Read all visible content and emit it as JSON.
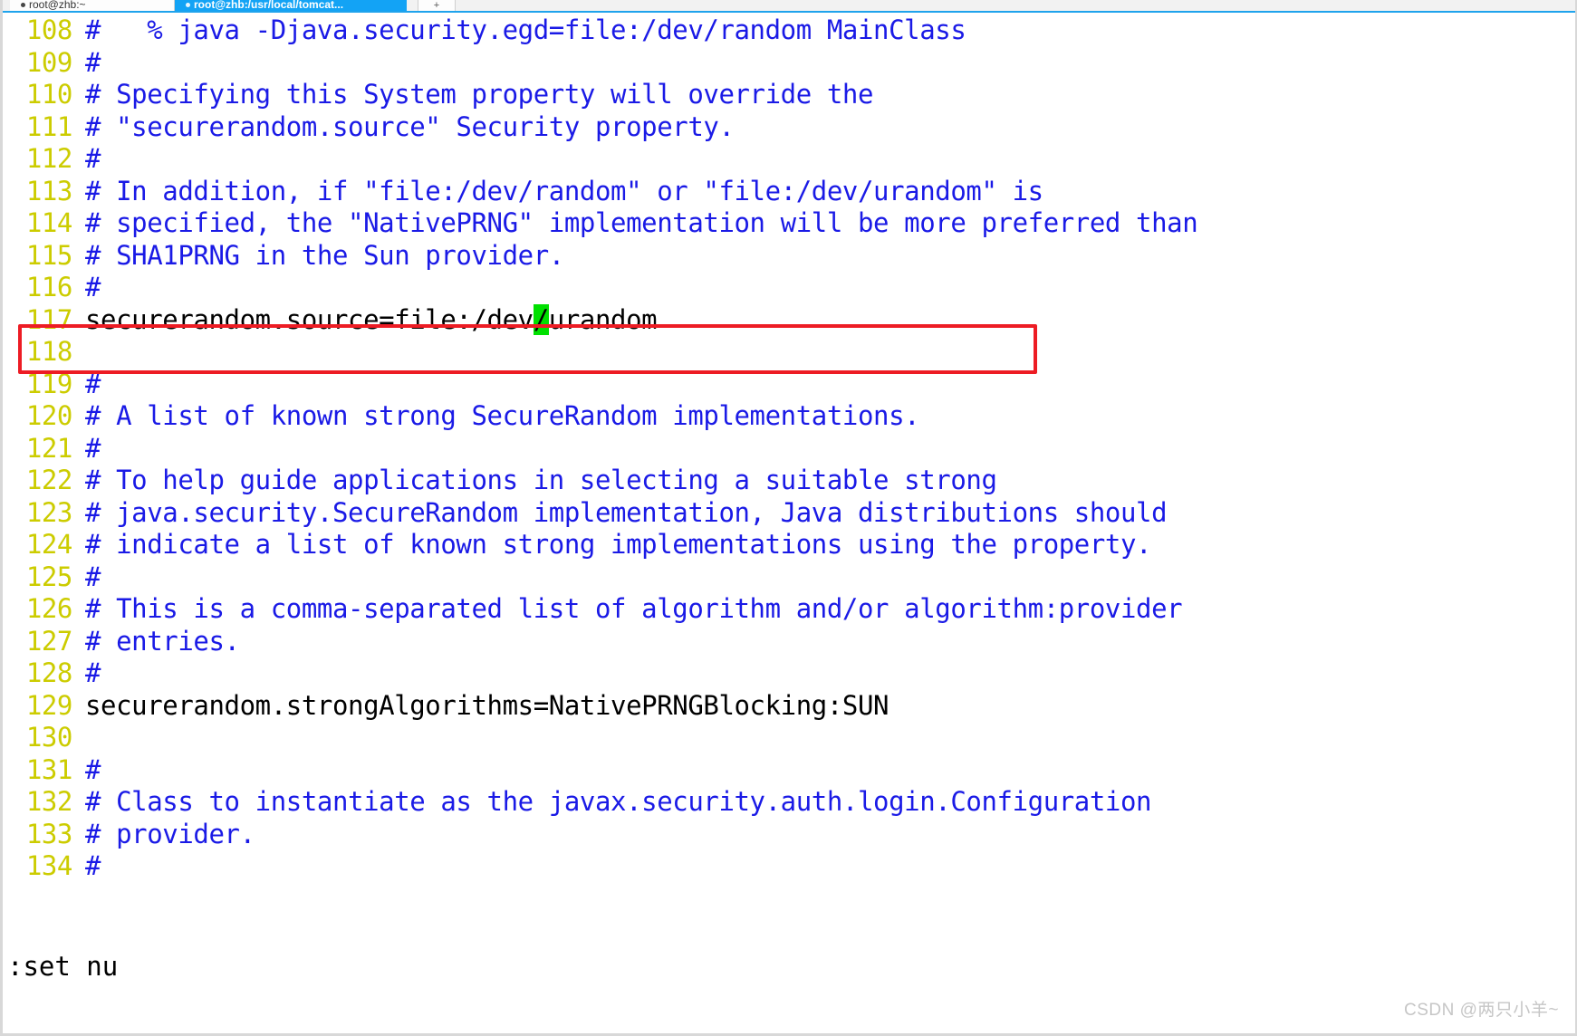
{
  "window": {
    "tabs": [
      {
        "label": "root@zhb:~",
        "active": false,
        "icon": "terminal-icon"
      },
      {
        "label": "root@zhb:/usr/local/tomcat...",
        "active": true,
        "icon": "terminal-icon"
      }
    ],
    "new_tab_label": "+"
  },
  "editor": {
    "first_line_number": 108,
    "lines": [
      {
        "num": "108",
        "text": "#   % java -Djava.security.egd=file:/dev/random MainClass",
        "style": "comment"
      },
      {
        "num": "109",
        "text": "#",
        "style": "comment"
      },
      {
        "num": "110",
        "text": "# Specifying this System property will override the",
        "style": "comment"
      },
      {
        "num": "111",
        "text": "# \"securerandom.source\" Security property.",
        "style": "comment"
      },
      {
        "num": "112",
        "text": "#",
        "style": "comment"
      },
      {
        "num": "113",
        "text": "# In addition, if \"file:/dev/random\" or \"file:/dev/urandom\" is",
        "style": "comment"
      },
      {
        "num": "114",
        "text": "# specified, the \"NativePRNG\" implementation will be more preferred than",
        "style": "comment"
      },
      {
        "num": "115",
        "text": "# SHA1PRNG in the Sun provider.",
        "style": "comment"
      },
      {
        "num": "116",
        "text": "#",
        "style": "comment"
      },
      {
        "num": "117",
        "text": "securerandom.source=file:/dev/urandom",
        "style": "plain",
        "cursor_index": 29
      },
      {
        "num": "118",
        "text": "",
        "style": "plain"
      },
      {
        "num": "119",
        "text": "#",
        "style": "comment"
      },
      {
        "num": "120",
        "text": "# A list of known strong SecureRandom implementations.",
        "style": "comment"
      },
      {
        "num": "121",
        "text": "#",
        "style": "comment"
      },
      {
        "num": "122",
        "text": "# To help guide applications in selecting a suitable strong",
        "style": "comment"
      },
      {
        "num": "123",
        "text": "# java.security.SecureRandom implementation, Java distributions should",
        "style": "comment"
      },
      {
        "num": "124",
        "text": "# indicate a list of known strong implementations using the property.",
        "style": "comment"
      },
      {
        "num": "125",
        "text": "#",
        "style": "comment"
      },
      {
        "num": "126",
        "text": "# This is a comma-separated list of algorithm and/or algorithm:provider",
        "style": "comment"
      },
      {
        "num": "127",
        "text": "# entries.",
        "style": "comment"
      },
      {
        "num": "128",
        "text": "#",
        "style": "comment"
      },
      {
        "num": "129",
        "text": "securerandom.strongAlgorithms=NativePRNGBlocking:SUN",
        "style": "plain"
      },
      {
        "num": "130",
        "text": "",
        "style": "plain"
      },
      {
        "num": "131",
        "text": "#",
        "style": "comment"
      },
      {
        "num": "132",
        "text": "# Class to instantiate as the javax.security.auth.login.Configuration",
        "style": "comment"
      },
      {
        "num": "133",
        "text": "# provider.",
        "style": "comment"
      },
      {
        "num": "134",
        "text": "#",
        "style": "comment"
      }
    ]
  },
  "status": {
    "command": ":set nu"
  },
  "annotation": {
    "highlight_line": "117",
    "color": "#ed1c24"
  },
  "colors": {
    "line_number": "#cccc00",
    "comment": "#1a1ae6",
    "plain_text": "#000000",
    "cursor_bg": "#00e000",
    "active_tab_bg": "#13a3f5",
    "annotation_red": "#ed1c24",
    "watermark": "#c6c6c6"
  },
  "watermark": {
    "text": "CSDN @两只小羊~"
  }
}
